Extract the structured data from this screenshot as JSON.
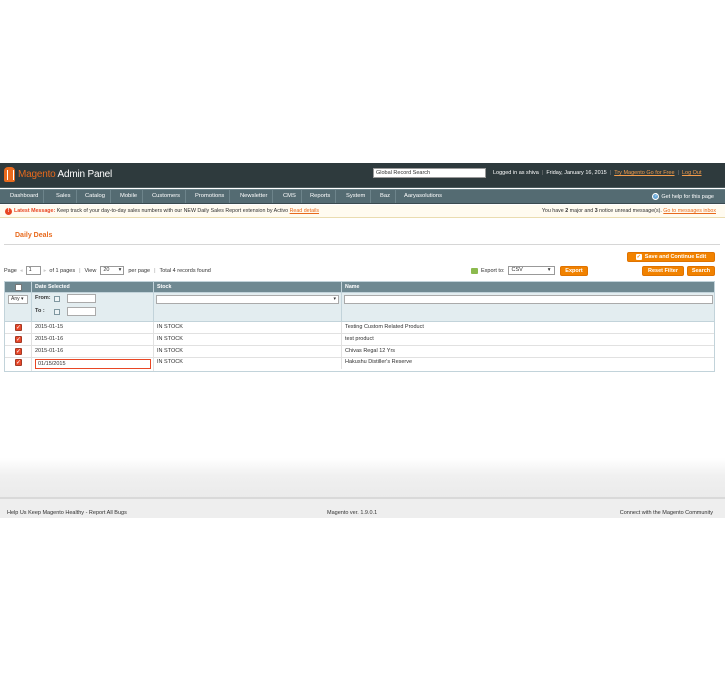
{
  "header": {
    "logo_word": "Magento",
    "logo_suffix": " Admin Panel",
    "search_placeholder": "Global Record Search",
    "logged_in": "Logged in as shiva",
    "date": "Friday, January 16, 2015",
    "try_link": "Try Magento Go for Free",
    "logout": "Log Out"
  },
  "nav": {
    "items": [
      "Dashboard",
      "Sales",
      "Catalog",
      "Mobile",
      "Customers",
      "Promotions",
      "Newsletter",
      "CMS",
      "Reports",
      "System",
      "Baz",
      "Aaryasolutions"
    ],
    "help": "Get help for this page"
  },
  "notice": {
    "label": "Latest Message:",
    "text": " Keep track of your day-to-day sales numbers with our NEW Daily Sales Report extension by Activo",
    "read_details": "Read details",
    "right_text_1": "You have ",
    "major_count": "2",
    "right_text_2": " major and ",
    "notice_count": "3",
    "right_text_3": " notice unread message(s). ",
    "inbox_link": "Go to messages inbox"
  },
  "page": {
    "title": "Daily Deals",
    "save_continue": "Save and Continue Edit",
    "reset_filter": "Reset Filter",
    "search": "Search"
  },
  "pager": {
    "page_label": "Page",
    "page_value": "1",
    "of_pages": "of 1 pages",
    "view_label": "View",
    "view_value": "20",
    "per_page": "per page",
    "total": "Total 4 records found"
  },
  "export": {
    "label": "Export to:",
    "value": "CSV",
    "button": "Export"
  },
  "grid": {
    "columns": [
      "Date Selected",
      "Stock",
      "Name"
    ],
    "filter": {
      "any": "Any",
      "from": "From:",
      "to": "To :"
    },
    "rows": [
      {
        "date": "2015-01-15",
        "stock": "IN STOCK",
        "name": "Testing Custom Related Product",
        "checked": true
      },
      {
        "date": "2015-01-16",
        "stock": "IN STOCK",
        "name": "test product",
        "checked": true
      },
      {
        "date": "2015-01-16",
        "stock": "IN STOCK",
        "name": "Chivas Regal 12 Yrs",
        "checked": true
      },
      {
        "date": "01/15/2015",
        "stock": "IN STOCK",
        "name": "Hakushu Distiller's Reserve",
        "checked": true
      }
    ]
  },
  "footer": {
    "left": "Help Us Keep Magento Healthy - Report All Bugs",
    "version": "Magento ver. 1.9.0.1",
    "right": "Connect with the Magento Community"
  },
  "colors": {
    "accent": "#e86a1d",
    "header_bg": "#2e3a3d",
    "nav_bg": "#546b72",
    "button": "#f18200"
  }
}
